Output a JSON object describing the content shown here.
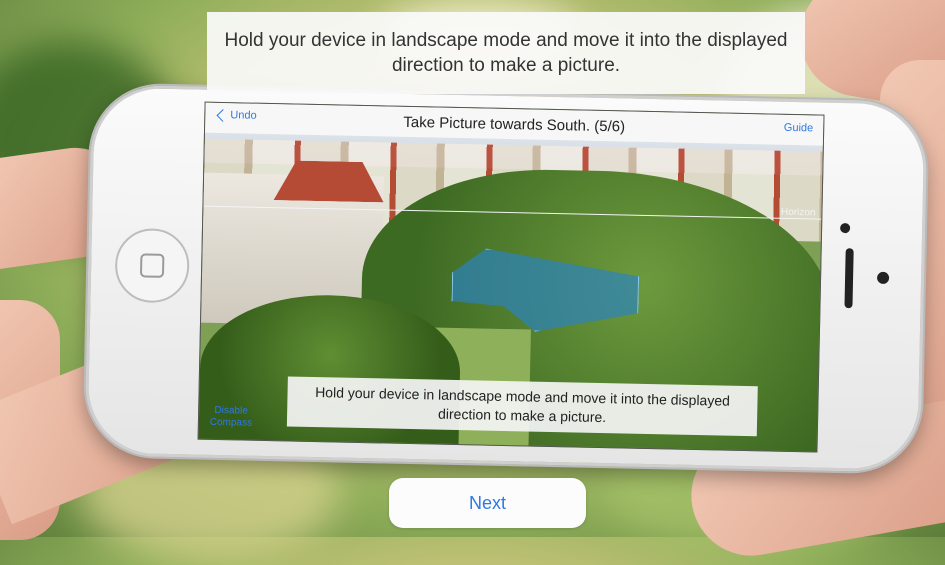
{
  "instruction_overlay": {
    "text": "Hold your device in landscape mode and move it into the displayed direction to make a picture."
  },
  "phone_screen": {
    "nav": {
      "back_label": "Undo",
      "title": "Take Picture towards South. (5/6)",
      "guide_label": "Guide"
    },
    "horizon_label": "Horizon",
    "instruction_text": "Hold your device in landscape mode and move it into the displayed direction to make a picture.",
    "compass_toggle_label": "Disable Compass"
  },
  "next_button": {
    "label": "Next"
  },
  "colors": {
    "accent": "#2d7ae0",
    "ar_box": "#2882c8"
  }
}
